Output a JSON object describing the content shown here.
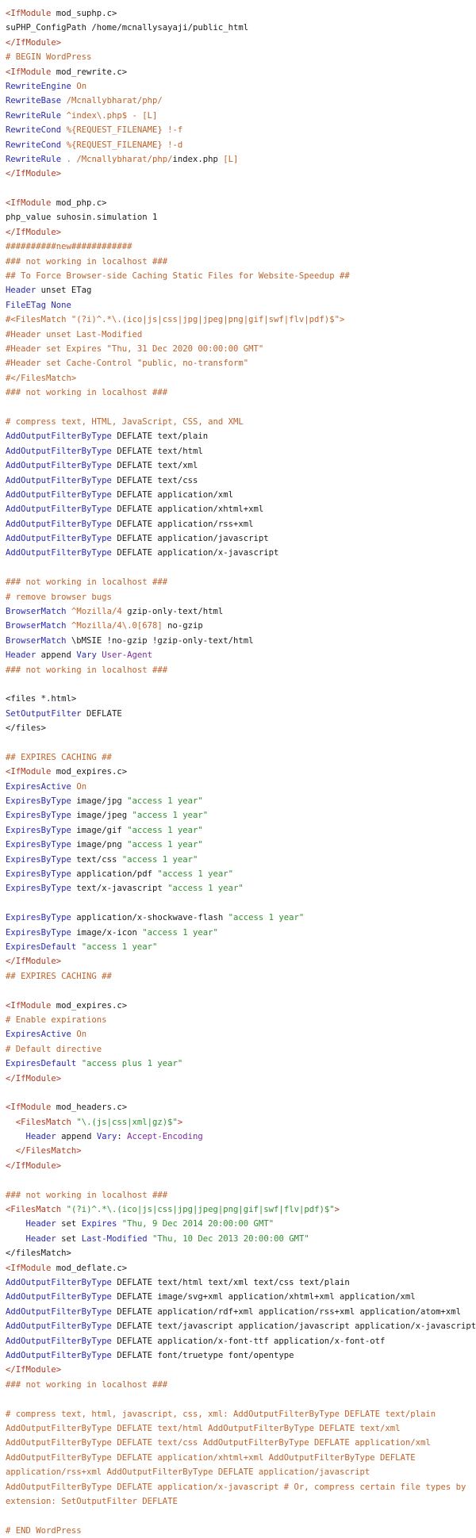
{
  "document": {
    "lines": [
      [
        [
          "t",
          "<IfModule"
        ],
        [
          "p",
          " mod_suphp.c>"
        ]
      ],
      [
        [
          "p",
          "suPHP_ConfigPath /home/mcnallysayaji/public_html"
        ]
      ],
      [
        [
          "t",
          "</IfModule>"
        ]
      ],
      [
        [
          "c",
          "# BEGIN WordPress"
        ]
      ],
      [
        [
          "t",
          "<IfModule"
        ],
        [
          "p",
          " mod_rewrite.c>"
        ]
      ],
      [
        [
          "k",
          "RewriteEngine"
        ],
        [
          "p",
          " "
        ],
        [
          "c",
          "On"
        ]
      ],
      [
        [
          "k",
          "RewriteBase"
        ],
        [
          "p",
          " "
        ],
        [
          "c",
          "/Mcnallybharat/php/"
        ]
      ],
      [
        [
          "k",
          "RewriteRule"
        ],
        [
          "p",
          " "
        ],
        [
          "c",
          "^index\\.php$ - [L]"
        ]
      ],
      [
        [
          "k",
          "RewriteCond"
        ],
        [
          "p",
          " "
        ],
        [
          "c",
          "%{REQUEST_FILENAME} !-f"
        ]
      ],
      [
        [
          "k",
          "RewriteCond"
        ],
        [
          "p",
          " "
        ],
        [
          "c",
          "%{REQUEST_FILENAME} !-d"
        ]
      ],
      [
        [
          "k",
          "RewriteRule"
        ],
        [
          "p",
          " "
        ],
        [
          "c",
          ". /Mcnallybharat/php/"
        ],
        [
          "p",
          "index.php "
        ],
        [
          "c",
          "[L]"
        ]
      ],
      [
        [
          "t",
          "</IfModule>"
        ]
      ],
      [],
      [
        [
          "t",
          "<IfModule"
        ],
        [
          "p",
          " mod_php.c>"
        ]
      ],
      [
        [
          "p",
          "php_value suhosin.simulation 1"
        ]
      ],
      [
        [
          "t",
          "</IfModule>"
        ]
      ],
      [
        [
          "c",
          "##########new############"
        ]
      ],
      [
        [
          "c",
          "### not working in localhost ###"
        ]
      ],
      [
        [
          "c",
          "## To Force Browser-side Caching Static Files for Website-Speedup ##"
        ]
      ],
      [
        [
          "k",
          "Header"
        ],
        [
          "p",
          " unset ETag"
        ]
      ],
      [
        [
          "k",
          "FileETag"
        ],
        [
          "p",
          " "
        ],
        [
          "k",
          "None"
        ]
      ],
      [
        [
          "c",
          "#<FilesMatch \"(?i)^.*\\.(ico|js|css|jpg|jpeg|png|gif|swf|flv|pdf)$\">"
        ]
      ],
      [
        [
          "c",
          "#Header unset Last-Modified"
        ]
      ],
      [
        [
          "c",
          "#Header set Expires \"Thu, 31 Dec 2020 00:00:00 GMT\""
        ]
      ],
      [
        [
          "c",
          "#Header set Cache-Control \"public, no-transform\""
        ]
      ],
      [
        [
          "c",
          "#</FilesMatch>"
        ]
      ],
      [
        [
          "c",
          "### not working in localhost ###"
        ]
      ],
      [],
      [
        [
          "c",
          "# compress text, HTML, JavaScript, CSS, and XML"
        ]
      ],
      [
        [
          "k",
          "AddOutputFilterByType"
        ],
        [
          "p",
          " DEFLATE text/plain"
        ]
      ],
      [
        [
          "k",
          "AddOutputFilterByType"
        ],
        [
          "p",
          " DEFLATE text/html"
        ]
      ],
      [
        [
          "k",
          "AddOutputFilterByType"
        ],
        [
          "p",
          " DEFLATE text/xml"
        ]
      ],
      [
        [
          "k",
          "AddOutputFilterByType"
        ],
        [
          "p",
          " DEFLATE text/css"
        ]
      ],
      [
        [
          "k",
          "AddOutputFilterByType"
        ],
        [
          "p",
          " DEFLATE application/xml"
        ]
      ],
      [
        [
          "k",
          "AddOutputFilterByType"
        ],
        [
          "p",
          " DEFLATE application/xhtml+xml"
        ]
      ],
      [
        [
          "k",
          "AddOutputFilterByType"
        ],
        [
          "p",
          " DEFLATE application/rss+xml"
        ]
      ],
      [
        [
          "k",
          "AddOutputFilterByType"
        ],
        [
          "p",
          " DEFLATE application/javascript"
        ]
      ],
      [
        [
          "k",
          "AddOutputFilterByType"
        ],
        [
          "p",
          " DEFLATE application/x-javascript"
        ]
      ],
      [],
      [
        [
          "c",
          "### not working in localhost ###"
        ]
      ],
      [
        [
          "c",
          "# remove browser bugs"
        ]
      ],
      [
        [
          "k",
          "BrowserMatch"
        ],
        [
          "p",
          " "
        ],
        [
          "c",
          "^Mozilla/4"
        ],
        [
          "p",
          " gzip-only-text/html"
        ]
      ],
      [
        [
          "k",
          "BrowserMatch"
        ],
        [
          "p",
          " "
        ],
        [
          "c",
          "^Mozilla/4\\.0[678]"
        ],
        [
          "p",
          " no-gzip"
        ]
      ],
      [
        [
          "k",
          "BrowserMatch"
        ],
        [
          "p",
          " \\bMSIE !no-gzip !gzip-only-text/html"
        ]
      ],
      [
        [
          "k",
          "Header"
        ],
        [
          "p",
          " append "
        ],
        [
          "k",
          "Vary"
        ],
        [
          "p",
          " "
        ],
        [
          "v",
          "User-Agent"
        ]
      ],
      [
        [
          "c",
          "### not working in localhost ###"
        ]
      ],
      [],
      [
        [
          "p",
          "<files *.html>"
        ]
      ],
      [
        [
          "k",
          "SetOutputFilter"
        ],
        [
          "p",
          " DEFLATE"
        ]
      ],
      [
        [
          "p",
          "</files>"
        ]
      ],
      [],
      [
        [
          "c",
          "## EXPIRES CACHING ##"
        ]
      ],
      [
        [
          "t",
          "<IfModule"
        ],
        [
          "p",
          " mod_expires.c>"
        ]
      ],
      [
        [
          "k",
          "ExpiresActive"
        ],
        [
          "p",
          " "
        ],
        [
          "c",
          "On"
        ]
      ],
      [
        [
          "k",
          "ExpiresByType"
        ],
        [
          "p",
          " image/jpg "
        ],
        [
          "s",
          "\"access 1 year\""
        ]
      ],
      [
        [
          "k",
          "ExpiresByType"
        ],
        [
          "p",
          " image/jpeg "
        ],
        [
          "s",
          "\"access 1 year\""
        ]
      ],
      [
        [
          "k",
          "ExpiresByType"
        ],
        [
          "p",
          " image/gif "
        ],
        [
          "s",
          "\"access 1 year\""
        ]
      ],
      [
        [
          "k",
          "ExpiresByType"
        ],
        [
          "p",
          " image/png "
        ],
        [
          "s",
          "\"access 1 year\""
        ]
      ],
      [
        [
          "k",
          "ExpiresByType"
        ],
        [
          "p",
          " text/css "
        ],
        [
          "s",
          "\"access 1 year\""
        ]
      ],
      [
        [
          "k",
          "ExpiresByType"
        ],
        [
          "p",
          " application/pdf "
        ],
        [
          "s",
          "\"access 1 year\""
        ]
      ],
      [
        [
          "k",
          "ExpiresByType"
        ],
        [
          "p",
          " text/x-javascript "
        ],
        [
          "s",
          "\"access 1 year\""
        ]
      ],
      [],
      [
        [
          "k",
          "ExpiresByType"
        ],
        [
          "p",
          " application/x-shockwave-flash "
        ],
        [
          "s",
          "\"access 1 year\""
        ]
      ],
      [
        [
          "k",
          "ExpiresByType"
        ],
        [
          "p",
          " image/x-icon "
        ],
        [
          "s",
          "\"access 1 year\""
        ]
      ],
      [
        [
          "k",
          "ExpiresDefault"
        ],
        [
          "p",
          " "
        ],
        [
          "s",
          "\"access 1 year\""
        ]
      ],
      [
        [
          "t",
          "</IfModule>"
        ]
      ],
      [
        [
          "c",
          "## EXPIRES CACHING ##"
        ]
      ],
      [],
      [
        [
          "t",
          "<IfModule"
        ],
        [
          "p",
          " mod_expires.c>"
        ]
      ],
      [
        [
          "c",
          "# Enable expirations"
        ]
      ],
      [
        [
          "k",
          "ExpiresActive"
        ],
        [
          "p",
          " "
        ],
        [
          "c",
          "On"
        ]
      ],
      [
        [
          "c",
          "# Default directive"
        ]
      ],
      [
        [
          "k",
          "ExpiresDefault"
        ],
        [
          "p",
          " "
        ],
        [
          "s",
          "\"access plus 1 year\""
        ]
      ],
      [
        [
          "t",
          "</IfModule>"
        ]
      ],
      [],
      [
        [
          "t",
          "<IfModule"
        ],
        [
          "p",
          " mod_headers.c>"
        ]
      ],
      [
        [
          "p",
          "  "
        ],
        [
          "t",
          "<FilesMatch"
        ],
        [
          "p",
          " "
        ],
        [
          "s",
          "\"\\.(js|css|xml|gz)$\""
        ],
        [
          "t",
          ">"
        ]
      ],
      [
        [
          "p",
          "    "
        ],
        [
          "k",
          "Header"
        ],
        [
          "p",
          " append "
        ],
        [
          "k",
          "Vary"
        ],
        [
          "p",
          ": "
        ],
        [
          "v",
          "Accept-Encoding"
        ]
      ],
      [
        [
          "p",
          "  "
        ],
        [
          "t",
          "</FilesMatch>"
        ]
      ],
      [
        [
          "t",
          "</IfModule>"
        ]
      ],
      [],
      [
        [
          "c",
          "### not working in localhost ###"
        ]
      ],
      [
        [
          "t",
          "<FilesMatch"
        ],
        [
          "p",
          " "
        ],
        [
          "s",
          "\"(?i)^.*\\.(ico|js|css|jpg|jpeg|png|gif|swf|flv|pdf)$\""
        ],
        [
          "t",
          ">"
        ]
      ],
      [
        [
          "p",
          "    "
        ],
        [
          "k",
          "Header"
        ],
        [
          "p",
          " set "
        ],
        [
          "k",
          "Expires"
        ],
        [
          "p",
          " "
        ],
        [
          "s",
          "\"Thu, 9 Dec 2014 20:00:00 GMT\""
        ]
      ],
      [
        [
          "p",
          "    "
        ],
        [
          "k",
          "Header"
        ],
        [
          "p",
          " set "
        ],
        [
          "k",
          "Last-Modified"
        ],
        [
          "p",
          " "
        ],
        [
          "s",
          "\"Thu, 10 Dec 2013 20:00:00 GMT\""
        ]
      ],
      [
        [
          "p",
          "</filesMatch>"
        ]
      ],
      [
        [
          "t",
          "<IfModule"
        ],
        [
          "p",
          " mod_deflate.c>"
        ]
      ],
      [
        [
          "k",
          "AddOutputFilterByType"
        ],
        [
          "p",
          " DEFLATE text/html text/xml text/css text/plain"
        ]
      ],
      [
        [
          "k",
          "AddOutputFilterByType"
        ],
        [
          "p",
          " DEFLATE image/svg+xml application/xhtml+xml application/xml"
        ]
      ],
      [
        [
          "k",
          "AddOutputFilterByType"
        ],
        [
          "p",
          " DEFLATE application/rdf+xml application/rss+xml application/atom+xml"
        ]
      ],
      [
        [
          "k",
          "AddOutputFilterByType"
        ],
        [
          "p",
          " DEFLATE text/javascript application/javascript application/x-javascript"
        ]
      ],
      [
        [
          "k",
          "AddOutputFilterByType"
        ],
        [
          "p",
          " DEFLATE application/x-font-ttf application/x-font-otf"
        ]
      ],
      [
        [
          "k",
          "AddOutputFilterByType"
        ],
        [
          "p",
          " DEFLATE font/truetype font/opentype"
        ]
      ],
      [
        [
          "t",
          "</IfModule>"
        ]
      ],
      [
        [
          "c",
          "### not working in localhost ###"
        ]
      ],
      [],
      {
        "wrap": true,
        "segs": [
          [
            "c",
            "# compress text, html, javascript, css, xml: AddOutputFilterByType DEFLATE text/plain AddOutputFilterByType DEFLATE text/html AddOutputFilterByType DEFLATE text/xml AddOutputFilterByType DEFLATE text/css AddOutputFilterByType DEFLATE application/xml AddOutputFilterByType DEFLATE application/xhtml+xml AddOutputFilterByType DEFLATE application/rss+xml AddOutputFilterByType DEFLATE application/javascript AddOutputFilterByType DEFLATE application/x-javascript # Or, compress certain file types by extension: SetOutputFilter DEFLATE"
          ]
        ]
      },
      [],
      [
        [
          "c",
          "# END WordPress"
        ]
      ]
    ]
  },
  "colors": {
    "keyword": "#2a2ab0",
    "tag": "#b03a20",
    "comment": "#c0622a",
    "string": "#2f8f2f",
    "variable": "#7a2aa0",
    "plain": "#1a1a1a"
  }
}
